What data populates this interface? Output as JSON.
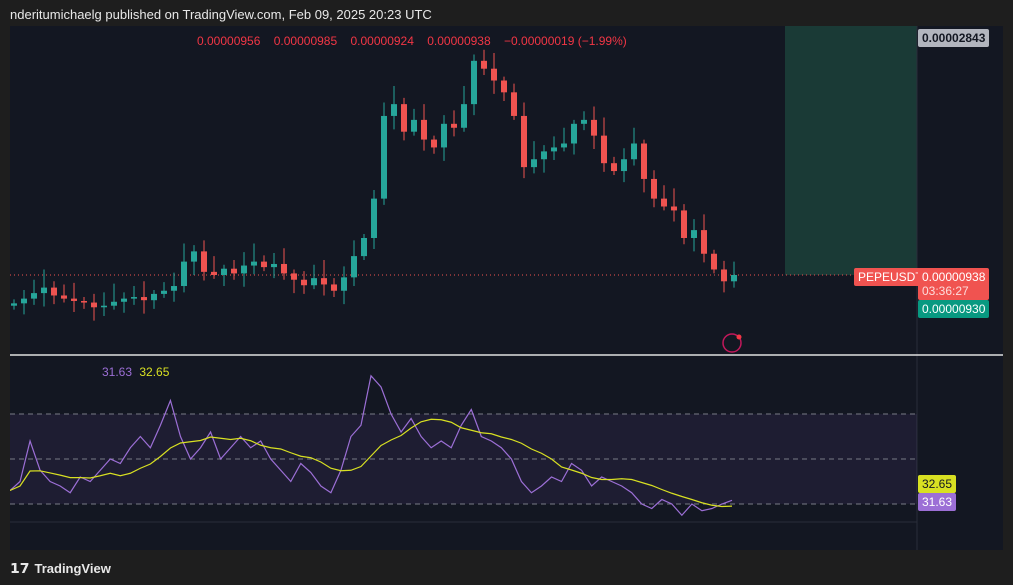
{
  "header": {
    "published": "nderitumichaelg published on TradingView.com, Feb 09, 2025 20:23 UTC"
  },
  "ohlc": {
    "open": "0.00000956",
    "high": "0.00000985",
    "low": "0.00000924",
    "close": "0.00000938",
    "change": "−0.00000019 (−1.99%)"
  },
  "price_axis": {
    "target_label": "0.00002843",
    "symbol": "PEPEUSDT",
    "last_price": "0.00000938",
    "countdown": "03:36:27",
    "bid_label": "0.00000930"
  },
  "rsi": {
    "value": "31.63",
    "ma_value": "32.65"
  },
  "footer": {
    "logo": "TradingView"
  },
  "colors": {
    "up": "#26a69a",
    "down": "#ef5350",
    "rsi": "#9c6fd6",
    "ma": "#d8e022",
    "position": "#1a3a36"
  },
  "chart_data": {
    "type": "candlestick",
    "symbol": "PEPEUSDT",
    "units": "1e-8 USDT",
    "closes": [
      9.02,
      9.08,
      9.15,
      9.22,
      9.12,
      9.08,
      9.05,
      9.03,
      8.97,
      8.99,
      9.04,
      9.08,
      9.1,
      9.06,
      9.14,
      9.18,
      9.24,
      9.55,
      9.68,
      9.42,
      9.38,
      9.46,
      9.4,
      9.5,
      9.55,
      9.48,
      9.52,
      9.4,
      9.32,
      9.25,
      9.34,
      9.26,
      9.18,
      9.35,
      9.62,
      9.85,
      10.35,
      11.4,
      11.55,
      11.2,
      11.35,
      11.1,
      11.0,
      11.3,
      11.25,
      11.55,
      12.1,
      12.0,
      11.85,
      11.7,
      11.4,
      10.75,
      10.85,
      10.95,
      11.0,
      11.05,
      11.3,
      11.35,
      11.15,
      10.8,
      10.7,
      10.85,
      11.05,
      10.6,
      10.35,
      10.25,
      10.2,
      9.85,
      9.95,
      9.65,
      9.45,
      9.3,
      9.38
    ],
    "rsi": [
      36,
      40,
      58,
      45,
      40,
      38,
      35,
      42,
      40,
      45,
      50,
      48,
      55,
      60,
      55,
      65,
      76,
      60,
      50,
      55,
      62,
      50,
      55,
      60,
      55,
      58,
      50,
      45,
      40,
      48,
      44,
      38,
      35,
      45,
      60,
      65,
      87,
      82,
      70,
      62,
      68,
      60,
      55,
      58,
      55,
      65,
      72,
      60,
      58,
      55,
      50,
      40,
      35,
      38,
      42,
      40,
      48,
      45,
      38,
      42,
      40,
      38,
      35,
      30,
      28,
      32,
      30,
      25,
      30,
      27,
      28,
      30,
      31.63
    ],
    "rsi_levels": [
      70,
      50,
      30
    ]
  }
}
